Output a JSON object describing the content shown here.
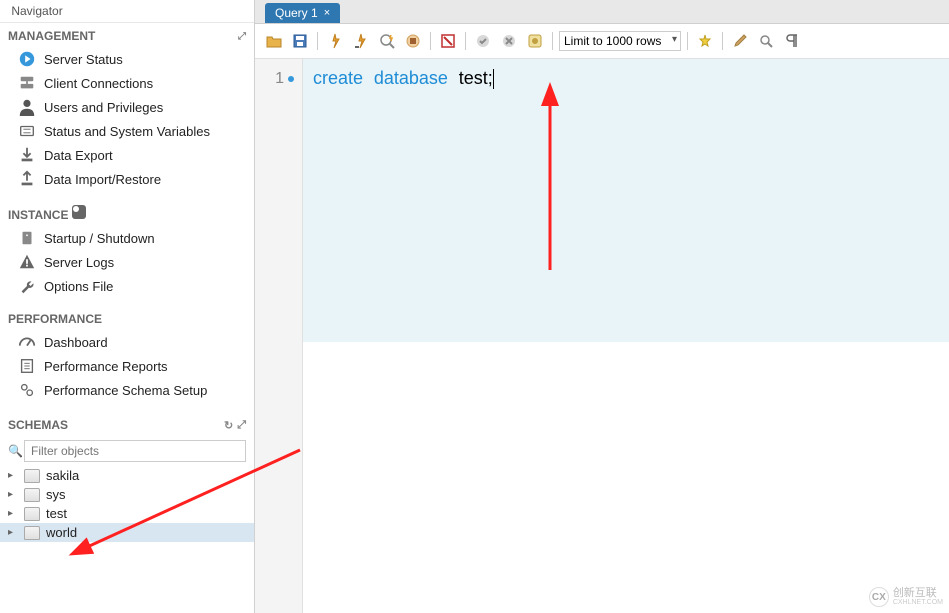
{
  "navigator": {
    "title": "Navigator",
    "management": {
      "header": "MANAGEMENT",
      "items": [
        {
          "label": "Server Status",
          "icon": "play"
        },
        {
          "label": "Client Connections",
          "icon": "connections"
        },
        {
          "label": "Users and Privileges",
          "icon": "users"
        },
        {
          "label": "Status and System Variables",
          "icon": "status"
        },
        {
          "label": "Data Export",
          "icon": "export"
        },
        {
          "label": "Data Import/Restore",
          "icon": "import"
        }
      ]
    },
    "instance": {
      "header": "INSTANCE",
      "items": [
        {
          "label": "Startup / Shutdown",
          "icon": "startup"
        },
        {
          "label": "Server Logs",
          "icon": "logs"
        },
        {
          "label": "Options File",
          "icon": "options"
        }
      ]
    },
    "performance": {
      "header": "PERFORMANCE",
      "items": [
        {
          "label": "Dashboard",
          "icon": "dashboard"
        },
        {
          "label": "Performance Reports",
          "icon": "reports"
        },
        {
          "label": "Performance Schema Setup",
          "icon": "schema"
        }
      ]
    },
    "schemas": {
      "header": "SCHEMAS",
      "filter_placeholder": "Filter objects",
      "items": [
        "sakila",
        "sys",
        "test",
        "world"
      ]
    }
  },
  "tab": {
    "label": "Query 1"
  },
  "toolbar": {
    "limit_label": "Limit to 1000 rows"
  },
  "editor": {
    "line1_num": "1",
    "line1_kw1": "create",
    "line1_kw2": "database",
    "line1_ident": "test;"
  },
  "watermark": {
    "brand": "创新互联",
    "sub": "CXHLNET.COM"
  }
}
